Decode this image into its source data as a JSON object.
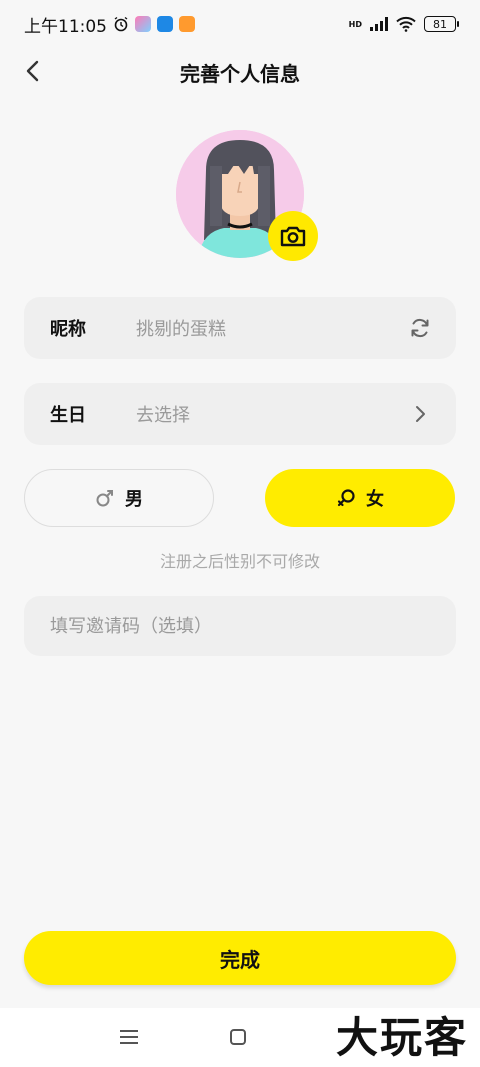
{
  "status_bar": {
    "time": "上午11:05",
    "network_label": "HD",
    "battery": "81"
  },
  "nav": {
    "title": "完善个人信息"
  },
  "nickname": {
    "label": "昵称",
    "value": "挑剔的蛋糕",
    "icon": "refresh-icon"
  },
  "birthday": {
    "label": "生日",
    "value": "去选择",
    "icon": "chevron-right-icon"
  },
  "gender": {
    "male_label": "男",
    "female_label": "女",
    "selected": "female",
    "hint": "注册之后性别不可修改"
  },
  "invite": {
    "placeholder": "填写邀请码（选填）"
  },
  "submit": {
    "label": "完成"
  },
  "colors": {
    "accent": "#ffec00",
    "background": "#f7f7f7",
    "field_bg": "#efefef",
    "avatar_bg": "#f6cbe9"
  },
  "watermark": "大玩客"
}
